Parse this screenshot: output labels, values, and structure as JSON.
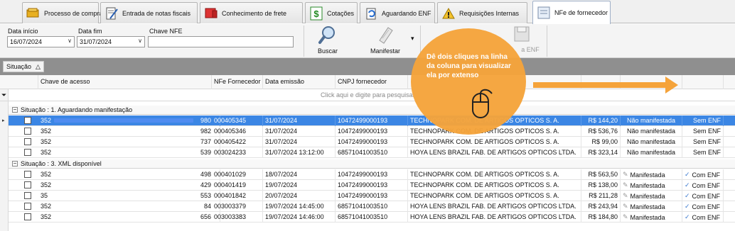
{
  "tabs": [
    {
      "label": "Processo de compra",
      "icon": "truck-box-icon"
    },
    {
      "label": "Entrada de notas fiscais",
      "icon": "document-pen-icon"
    },
    {
      "label": "Conhecimento de frete",
      "icon": "freight-truck-icon"
    },
    {
      "label": "Cotações",
      "icon": "dollar-icon"
    },
    {
      "label": "Aguardando ENF",
      "icon": "refresh-doc-icon"
    },
    {
      "label": "Requisições Internas",
      "icon": "warning-icon"
    },
    {
      "label": "NFe de fornecedor",
      "icon": "nfe-doc-icon"
    }
  ],
  "filters": {
    "data_inicio_label": "Data início",
    "data_inicio_value": "16/07/2024",
    "data_fim_label": "Data fim",
    "data_fim_value": "31/07/2024",
    "chave_label": "Chave NFE",
    "chave_value": ""
  },
  "toolbar": {
    "buscar": "Buscar",
    "manifestar": "Manifestar",
    "hidden_label": "a ENF"
  },
  "group_panel": {
    "chip": "Situação",
    "sort": "△"
  },
  "columns": {
    "chave": "Chave de acesso",
    "nfe": "NFe Fornecedor",
    "data": "Data emissão",
    "cnpj": "CNPJ fornecedor"
  },
  "filter_hint": "Click aqui e digite para pesquisar",
  "groups": [
    {
      "label": "Situação : 1. Aguardando manifestação",
      "rows": [
        {
          "chave_a": "352",
          "chave_b": "980",
          "nfe": "000405345",
          "data": "31/07/2024",
          "cnpj": "10472499000193",
          "razao": "TECHNOPARK COM. DE ARTIGOS OPTICOS S. A.",
          "valor": "R$ 144,20",
          "status": "Não manifestada",
          "enf": "Sem ENF",
          "selected": true
        },
        {
          "chave_a": "352",
          "chave_b": "982",
          "nfe": "000405346",
          "data": "31/07/2024",
          "cnpj": "10472499000193",
          "razao": "TECHNOPARK COM. DE ARTIGOS OPTICOS S. A.",
          "valor": "R$ 536,76",
          "status": "Não manifestada",
          "enf": "Sem ENF",
          "selected": false
        },
        {
          "chave_a": "352",
          "chave_b": "737",
          "nfe": "000405422",
          "data": "31/07/2024",
          "cnpj": "10472499000193",
          "razao": "TECHNOPARK COM. DE ARTIGOS OPTICOS S. A.",
          "valor": "R$ 99,00",
          "status": "Não manifestada",
          "enf": "Sem ENF",
          "selected": false
        },
        {
          "chave_a": "352",
          "chave_b": "539",
          "nfe": "003024233",
          "data": "31/07/2024 13:12:00",
          "cnpj": "68571041003510",
          "razao": "HOYA LENS BRAZIL FAB. DE ARTIGOS OPTICOS LTDA.",
          "valor": "R$ 323,14",
          "status": "Não manifestada",
          "enf": "Sem ENF",
          "selected": false
        }
      ]
    },
    {
      "label": "Situação : 3. XML disponível",
      "rows": [
        {
          "chave_a": "352",
          "chave_b": "498",
          "nfe": "000401029",
          "data": "18/07/2024",
          "cnpj": "10472499000193",
          "razao": "TECHNOPARK COM. DE ARTIGOS OPTICOS S. A.",
          "valor": "R$ 563,50",
          "status": "Manifestada",
          "enf": "Com ENF",
          "selected": false
        },
        {
          "chave_a": "352",
          "chave_b": "429",
          "nfe": "000401419",
          "data": "19/07/2024",
          "cnpj": "10472499000193",
          "razao": "TECHNOPARK COM. DE ARTIGOS OPTICOS S. A.",
          "valor": "R$ 138,00",
          "status": "Manifestada",
          "enf": "Com ENF",
          "selected": false
        },
        {
          "chave_a": "35",
          "chave_b": "553",
          "nfe": "000401842",
          "data": "20/07/2024",
          "cnpj": "10472499000193",
          "razao": "TECHNOPARK COM. DE ARTIGOS OPTICOS S. A.",
          "valor": "R$ 211,28",
          "status": "Manifestada",
          "enf": "Com ENF",
          "selected": false
        },
        {
          "chave_a": "352",
          "chave_b": "84",
          "nfe": "003003379",
          "data": "19/07/2024 14:45:00",
          "cnpj": "68571041003510",
          "razao": "HOYA LENS BRAZIL FAB. DE ARTIGOS OPTICOS LTDA.",
          "valor": "R$ 243,94",
          "status": "Manifestada",
          "enf": "Com ENF",
          "selected": false
        },
        {
          "chave_a": "352",
          "chave_b": "656",
          "nfe": "003003383",
          "data": "19/07/2024 14:46:00",
          "cnpj": "68571041003510",
          "razao": "HOYA LENS BRAZIL FAB. DE ARTIGOS OPTICOS LTDA.",
          "valor": "R$ 184,80",
          "status": "Manifestada",
          "enf": "Com ENF",
          "selected": false
        }
      ]
    }
  ],
  "tooltip": {
    "text": "Dê dois cliques na linha da coluna para visualizar ela por extenso",
    "icon": "mouse-icon",
    "color": "#f5a33a"
  },
  "colors": {
    "selection": "#3b86e4",
    "group_panel": "#8f8f8f"
  }
}
